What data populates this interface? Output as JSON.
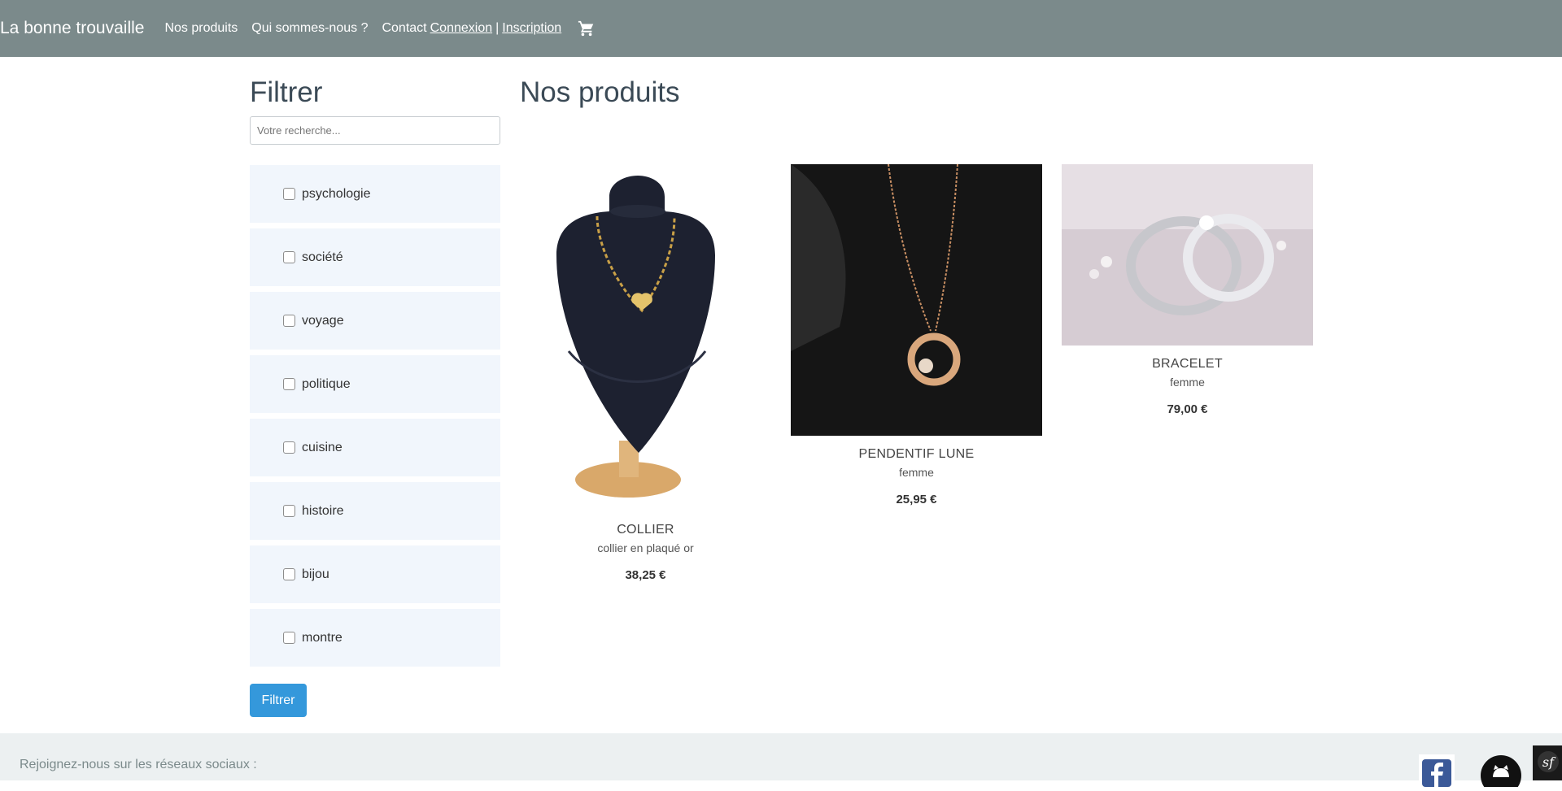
{
  "navbar": {
    "brand": "La bonne trouvaille",
    "links": [
      "Nos produits",
      "Qui sommes-nous ?",
      "Contact"
    ],
    "login": "Connexion",
    "separator": "|",
    "register": "Inscription",
    "cart_icon": "cart-icon"
  },
  "sidebar": {
    "title": "Filtrer",
    "search_placeholder": "Votre recherche...",
    "categories": [
      "psychologie",
      "société",
      "voyage",
      "politique",
      "cuisine",
      "histoire",
      "bijou",
      "montre"
    ],
    "button": "Filtrer"
  },
  "main": {
    "title": "Nos produits",
    "products": [
      {
        "name": "COLLIER",
        "description": "collier en plaqué or",
        "price": "38,25 €"
      },
      {
        "name": "PENDENTIF LUNE",
        "description": "femme",
        "price": "25,95 €"
      },
      {
        "name": "BRACELET",
        "description": "femme",
        "price": "79,00 €"
      }
    ]
  },
  "footer": {
    "text": "Rejoignez-nous sur les réseaux sociaux :",
    "icons": [
      "facebook-icon",
      "github-icon",
      "symfony-icon"
    ]
  },
  "colors": {
    "navbar": "#7b8a8b",
    "filter_bg": "#f1f6fc",
    "button": "#3498db",
    "footer": "#ecf0f1"
  }
}
